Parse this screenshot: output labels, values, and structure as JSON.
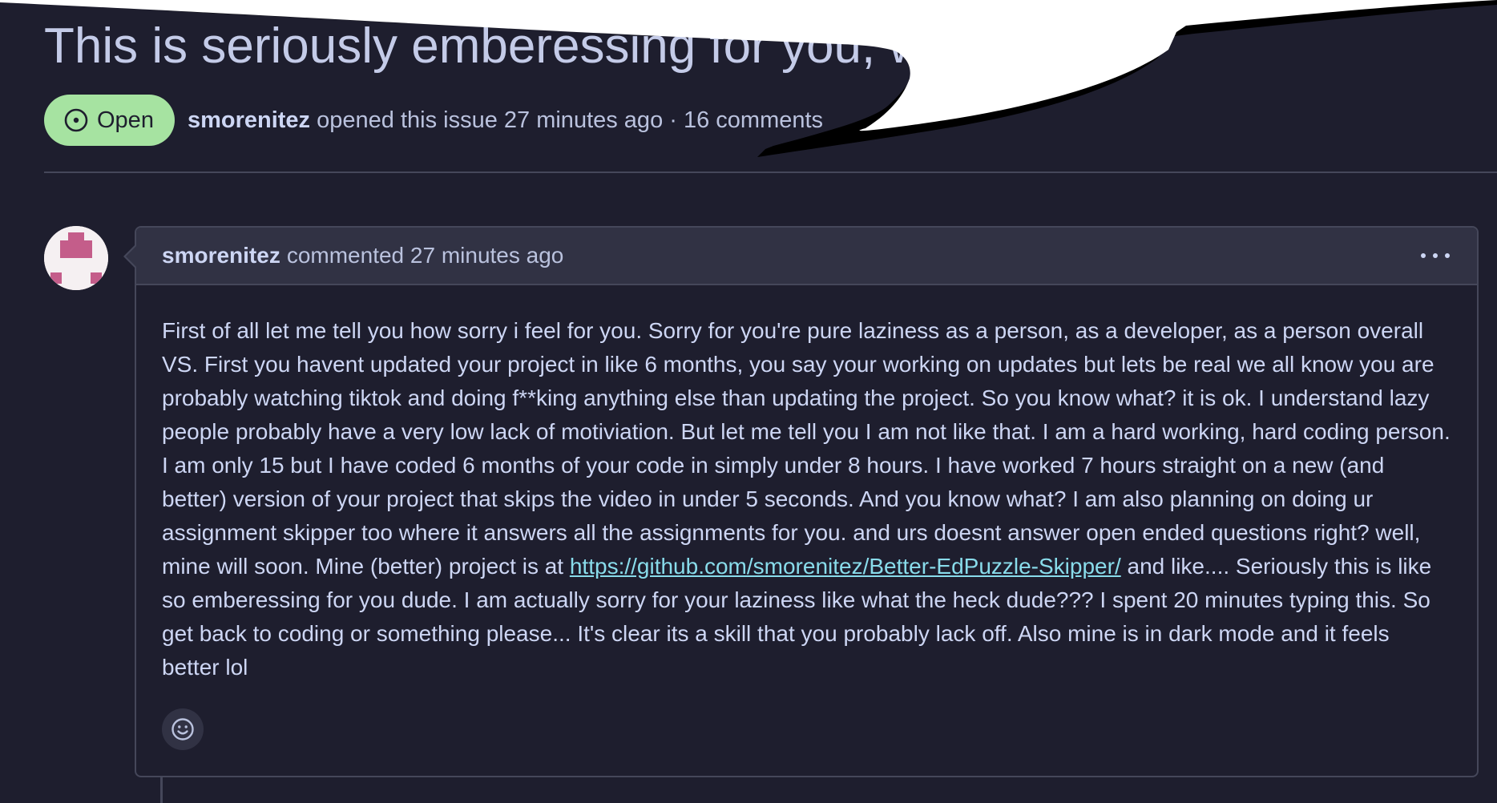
{
  "issue": {
    "title": "This is seriously emberessing for you, w",
    "state": "Open",
    "state_icon": "issue-opened-icon",
    "author": "smorenitez",
    "meta": "opened this issue 27 minutes ago · 16 comments"
  },
  "comment": {
    "author": "smorenitez",
    "action": "commented 27 minutes ago",
    "body_before_link": "First of all let me tell you how sorry i feel for you. Sorry for you're pure laziness as a person, as a developer, as a person overall VS. First you havent updated your project in like 6 months, you say your working on updates but lets be real we all know you are probably watching tiktok and doing f**king anything else than updating the project. So you know what? it is ok. I understand lazy people probably have a very low lack of motiviation. But let me tell you I am not like that. I am a hard working, hard coding person. I am only 15 but I have coded 6 months of your code in simply under 8 hours. I have worked 7 hours straight on a new (and better) version of your project that skips the video in under 5 seconds. And you know what? I am also planning on doing ur assignment skipper too where it answers all the assignments for you. and urs doesnt answer open ended questions right? well, mine will soon. Mine (better) project is at ",
    "link_text": "https://github.com/smorenitez/Better-EdPuzzle-Skipper/",
    "body_after_link": " and like.... Seriously this is like so emberessing for you dude. I am actually sorry for your laziness like what the heck dude??? I spent 20 minutes typing this. So get back to coding or something please... It's clear its a skill that you probably lack off. Also mine is in dark mode and it feels better lol",
    "menu_icon": "kebab-horizontal-icon",
    "reaction_icon": "smiley-icon"
  },
  "colors": {
    "background": "#1e1e2e",
    "header_bg": "#313244",
    "border": "#45475a",
    "open_badge": "#a6e3a1",
    "link": "#89dceb",
    "avatar_accent": "#c45d8a"
  }
}
